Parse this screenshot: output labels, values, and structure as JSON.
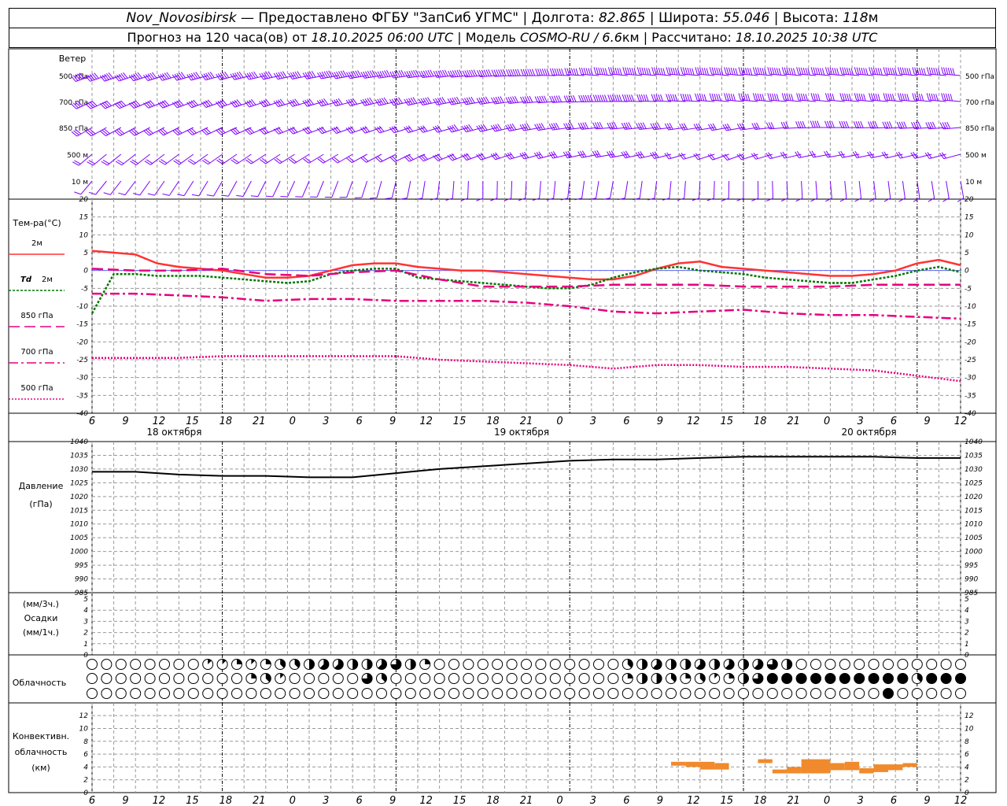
{
  "header": {
    "line1": [
      {
        "t": "Nov_Novosibirsk",
        "i": true
      },
      {
        "t": " — Предоставлено ФГБУ \"ЗапСиб УГМС\" | Долгота: ",
        "i": false
      },
      {
        "t": "82.865",
        "i": true
      },
      {
        "t": " | Широта: ",
        "i": false
      },
      {
        "t": "55.046",
        "i": true
      },
      {
        "t": " | Высота: ",
        "i": false
      },
      {
        "t": "118",
        "i": true
      },
      {
        "t": "м",
        "i": false
      }
    ],
    "line2": [
      {
        "t": "Прогноз на 120 часа(ов) от ",
        "i": false
      },
      {
        "t": "18.10.2025 06:00 UTC",
        "i": true
      },
      {
        "t": " | Модель ",
        "i": false
      },
      {
        "t": "COSMO-RU / 6.6",
        "i": true
      },
      {
        "t": "км | Рассчитано: ",
        "i": false
      },
      {
        "t": "18.10.2025 10:38 UTC",
        "i": true
      }
    ]
  },
  "time_axis": {
    "hour_labels": [
      "6",
      "9",
      "12",
      "15",
      "18",
      "21",
      "0",
      "3",
      "6",
      "9",
      "12",
      "15",
      "18",
      "21",
      "0",
      "3",
      "6",
      "9",
      "12",
      "15",
      "18",
      "21",
      "0",
      "3",
      "6",
      "9",
      "12"
    ],
    "date_labels": [
      "18 октября",
      "19 октября",
      "20 октября"
    ]
  },
  "chart_data": [
    {
      "type": "wind_barbs",
      "title": "Ветер",
      "levels": [
        "500 гПа",
        "700 гПа",
        "850 гПа",
        "500 м",
        "10 м"
      ],
      "colors": {
        "barb": "#7f00ff"
      },
      "note_values": "direction(deg) and speed(m/s) estimated per level at forecast hours 0,18,36,54,72,90,102,120",
      "samples_hours": [
        0,
        18,
        36,
        54,
        72,
        90,
        102,
        120
      ],
      "direction": [
        [
          250,
          255,
          260,
          265,
          275,
          275,
          275,
          275
        ],
        [
          245,
          250,
          255,
          260,
          270,
          275,
          275,
          275
        ],
        [
          240,
          245,
          250,
          255,
          265,
          260,
          270,
          265
        ],
        [
          230,
          235,
          240,
          250,
          260,
          250,
          260,
          255
        ],
        [
          220,
          210,
          200,
          180,
          190,
          180,
          175,
          170
        ]
      ],
      "speed": [
        [
          25,
          25,
          28,
          30,
          35,
          30,
          28,
          30
        ],
        [
          18,
          20,
          22,
          25,
          28,
          25,
          22,
          25
        ],
        [
          14,
          15,
          15,
          18,
          20,
          15,
          18,
          18
        ],
        [
          10,
          10,
          12,
          13,
          15,
          10,
          12,
          12
        ],
        [
          4,
          4,
          3,
          3,
          3,
          3,
          3,
          3
        ]
      ]
    },
    {
      "type": "line",
      "title": "Тем-ра(°С)",
      "ylim": [
        -40,
        20
      ],
      "yticks": [
        "20",
        "15",
        "10",
        "5",
        "0",
        "-5",
        "-10",
        "-15",
        "-20",
        "-25",
        "-30",
        "-35",
        "-40"
      ],
      "series": [
        {
          "name": "2м",
          "color": "#ff3333",
          "dash": "",
          "hours": [
            0,
            3,
            6,
            9,
            12,
            15,
            18,
            21,
            24,
            27,
            30,
            33,
            36,
            39,
            42,
            45,
            48,
            51,
            54,
            57,
            60,
            63,
            66,
            69,
            72,
            75,
            78,
            81,
            84,
            87,
            90,
            93,
            96,
            99,
            102,
            105,
            108,
            111,
            114,
            117,
            120
          ],
          "values": [
            5.5,
            5,
            4.5,
            2,
            1,
            0.5,
            0,
            -1,
            -2,
            -2,
            -1.5,
            0,
            1.5,
            2,
            2,
            1,
            0.5,
            0,
            0,
            -0.5,
            -1,
            -1.5,
            -2,
            -2.5,
            -2.5,
            -1.5,
            0.5,
            2,
            2.5,
            1,
            0.5,
            0,
            -0.5,
            -1,
            -1.5,
            -1.5,
            -1,
            0,
            2,
            3,
            1.5
          ]
        },
        {
          "name": "Td 2м",
          "color": "#007700",
          "dash": "3,2",
          "hours": [
            0,
            3,
            6,
            9,
            12,
            15,
            18,
            21,
            24,
            27,
            30,
            33,
            36,
            39,
            42,
            45,
            48,
            51,
            54,
            57,
            60,
            63,
            66,
            69,
            72,
            75,
            78,
            81,
            84,
            87,
            90,
            93,
            96,
            99,
            102,
            105,
            108,
            111,
            114,
            117,
            120
          ],
          "values": [
            -12,
            -1,
            -1,
            -1.5,
            -1.5,
            -1.5,
            -2,
            -2.5,
            -3,
            -3.5,
            -3,
            -1,
            0,
            0.5,
            0.5,
            -2,
            -2.5,
            -3,
            -3.5,
            -4,
            -4.5,
            -5,
            -5,
            -4,
            -2,
            -0.5,
            0.5,
            1,
            0,
            -0.5,
            -1,
            -2,
            -2.5,
            -3,
            -3.5,
            -3.5,
            -2.5,
            -1.5,
            0,
            1,
            -0.5
          ]
        },
        {
          "name": "850 гПа",
          "color": "#e6007e",
          "dash": "14,6",
          "hours": [
            0,
            6,
            12,
            18,
            24,
            30,
            36,
            42,
            48,
            54,
            60,
            66,
            72,
            78,
            84,
            90,
            96,
            102,
            108,
            114,
            120
          ],
          "values": [
            0.5,
            0,
            0,
            0.5,
            -1,
            -1.5,
            -0.5,
            0,
            -2.5,
            -4.5,
            -4.5,
            -4.5,
            -4,
            -4,
            -4,
            -4.5,
            -4.5,
            -4.5,
            -4,
            -4,
            -4
          ]
        },
        {
          "name": "700 гПа",
          "color": "#e6007e",
          "dash": "12,4,3,4",
          "hours": [
            0,
            6,
            12,
            18,
            24,
            30,
            36,
            42,
            48,
            54,
            60,
            66,
            72,
            78,
            84,
            90,
            96,
            102,
            108,
            114,
            120
          ],
          "values": [
            -6.5,
            -6.5,
            -7,
            -7.5,
            -8.5,
            -8,
            -8,
            -8.5,
            -8.5,
            -8.5,
            -9,
            -10,
            -11.5,
            -12,
            -11.5,
            -11,
            -12,
            -12.5,
            -12.5,
            -13,
            -13.5
          ]
        },
        {
          "name": "500 гПа",
          "color": "#e6007e",
          "dash": "2,2",
          "hours": [
            0,
            6,
            12,
            18,
            24,
            30,
            36,
            42,
            48,
            54,
            60,
            66,
            72,
            78,
            84,
            90,
            96,
            102,
            108,
            114,
            120
          ],
          "values": [
            -24.5,
            -24.5,
            -24.5,
            -24,
            -24,
            -24,
            -24,
            -24,
            -25,
            -25.5,
            -26,
            -26.5,
            -27.5,
            -26.5,
            -26.5,
            -27,
            -27,
            -27.5,
            -28,
            -29.5,
            -31
          ]
        }
      ]
    },
    {
      "type": "line",
      "title": "Давление",
      "ylabel": "(гПа)",
      "ylim": [
        985,
        1040
      ],
      "yticks": [
        "1040",
        "1035",
        "1030",
        "1025",
        "1020",
        "1015",
        "1010",
        "1005",
        "1000",
        "995",
        "990",
        "985"
      ],
      "series": [
        {
          "color": "#000000",
          "hours": [
            0,
            6,
            12,
            18,
            24,
            30,
            36,
            42,
            48,
            54,
            60,
            66,
            72,
            78,
            84,
            90,
            96,
            102,
            108,
            114,
            120
          ],
          "values": [
            1029,
            1029,
            1028,
            1027.5,
            1027.5,
            1027,
            1027,
            1028.5,
            1030,
            1031,
            1032,
            1033,
            1033.5,
            1033.5,
            1034,
            1034.5,
            1034.5,
            1034.5,
            1034.5,
            1034,
            1034
          ]
        }
      ]
    },
    {
      "type": "bar",
      "title": "Осадки",
      "ylabel": "(мм/3ч.)",
      "ylabel2": "(мм/1ч.)",
      "ylim": [
        0,
        5
      ],
      "yticks": [
        "5",
        "4",
        "3",
        "2",
        "1",
        "0"
      ],
      "values": []
    },
    {
      "type": "table",
      "title": "Облачность",
      "legend": "cloud cover fraction in eighths per hourly symbol; rows: upper, middle, lower layer",
      "rows": [
        {
          "layer": "upper",
          "segments": [
            [
              0,
              0
            ],
            [
              8,
              1
            ],
            [
              9,
              1
            ],
            [
              10,
              2
            ],
            [
              11,
              1
            ],
            [
              12,
              2
            ],
            [
              13,
              3
            ],
            [
              14,
              3
            ],
            [
              15,
              4
            ],
            [
              16,
              5
            ],
            [
              17,
              5
            ],
            [
              18,
              4
            ],
            [
              19,
              4
            ],
            [
              20,
              5
            ],
            [
              21,
              6
            ],
            [
              22,
              4
            ],
            [
              23,
              2
            ],
            [
              24,
              0
            ],
            [
              36,
              0
            ],
            [
              37,
              3
            ],
            [
              38,
              4
            ],
            [
              39,
              5
            ],
            [
              40,
              4
            ],
            [
              41,
              4
            ],
            [
              42,
              5
            ],
            [
              43,
              4
            ],
            [
              44,
              5
            ],
            [
              45,
              4
            ],
            [
              46,
              5
            ],
            [
              47,
              6
            ],
            [
              48,
              4
            ],
            [
              49,
              0
            ],
            [
              60,
              0
            ]
          ]
        },
        {
          "layer": "middle",
          "segments": [
            [
              0,
              0
            ],
            [
              10,
              0
            ],
            [
              11,
              2
            ],
            [
              12,
              3
            ],
            [
              13,
              1
            ],
            [
              14,
              0
            ],
            [
              18,
              0
            ],
            [
              19,
              6
            ],
            [
              20,
              3
            ],
            [
              21,
              0
            ],
            [
              36,
              0
            ],
            [
              37,
              2
            ],
            [
              38,
              4
            ],
            [
              39,
              4
            ],
            [
              40,
              3
            ],
            [
              41,
              2
            ],
            [
              42,
              3
            ],
            [
              43,
              1
            ],
            [
              44,
              2
            ],
            [
              45,
              4
            ],
            [
              46,
              6
            ],
            [
              47,
              8
            ],
            [
              56,
              8
            ],
            [
              57,
              3
            ],
            [
              58,
              8
            ],
            [
              60,
              8
            ]
          ]
        },
        {
          "layer": "lower",
          "segments": [
            [
              0,
              0
            ],
            [
              54,
              0
            ],
            [
              55,
              8
            ],
            [
              56,
              0
            ],
            [
              60,
              0
            ]
          ]
        }
      ]
    },
    {
      "type": "bar",
      "title": "Конвективн. облачность",
      "ylabel": "(км)",
      "ylim": [
        0,
        13
      ],
      "yticks": [
        "12",
        "10",
        "8",
        "6",
        "4",
        "2",
        "0"
      ],
      "colors": {
        "fill": "#f08a2c"
      },
      "cells": [
        [
          80,
          4.2,
          4.8
        ],
        [
          82,
          4,
          4.8
        ],
        [
          84,
          3.6,
          4.8
        ],
        [
          86,
          3.6,
          4.6
        ],
        [
          92,
          4.6,
          5.2
        ],
        [
          94,
          3.0,
          3.6
        ],
        [
          96,
          3.0,
          4.0
        ],
        [
          98,
          3.0,
          5.2
        ],
        [
          100,
          3.0,
          5.2
        ],
        [
          102,
          3.5,
          4.6
        ],
        [
          104,
          3.5,
          4.8
        ],
        [
          106,
          3.0,
          3.8
        ],
        [
          108,
          3.2,
          4.4
        ],
        [
          110,
          3.5,
          4.4
        ],
        [
          112,
          4.0,
          4.6
        ]
      ]
    }
  ],
  "panel_labels": {
    "wind": "Ветер",
    "temp": "Тем-ра(°С)",
    "pressure": "Давление",
    "pressure_unit": "(гПа)",
    "precip_unit1": "(мм/3ч.)",
    "precip": "Осадки",
    "precip_unit2": "(мм/1ч.)",
    "clouds": "Облачность",
    "conv1": "Конвективн.",
    "conv2": "облачность",
    "conv3": "(км)"
  },
  "temp_legend": [
    "2м",
    "Td",
    "2м",
    "850 гПа",
    "700 гПа",
    "500 гПа"
  ]
}
